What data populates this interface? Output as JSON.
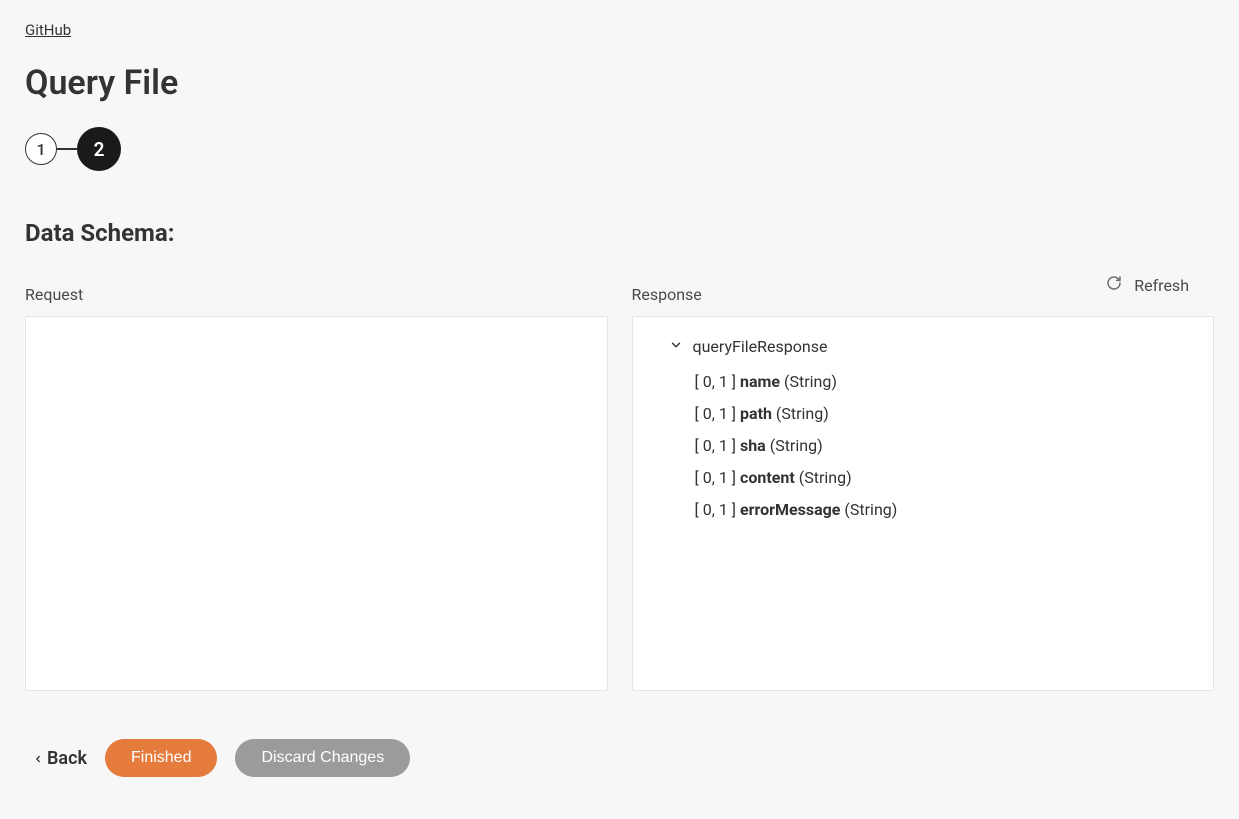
{
  "breadcrumb": {
    "label": "GitHub"
  },
  "page": {
    "title": "Query File"
  },
  "stepper": {
    "steps": [
      "1",
      "2"
    ],
    "activeIndex": 1
  },
  "section": {
    "title": "Data Schema:"
  },
  "toolbar": {
    "refresh_label": "Refresh"
  },
  "panels": {
    "request": {
      "label": "Request"
    },
    "response": {
      "label": "Response",
      "tree": {
        "root": "queryFileResponse",
        "fields": [
          {
            "cardinality": "[ 0, 1 ]",
            "name": "name",
            "type": "(String)"
          },
          {
            "cardinality": "[ 0, 1 ]",
            "name": "path",
            "type": "(String)"
          },
          {
            "cardinality": "[ 0, 1 ]",
            "name": "sha",
            "type": "(String)"
          },
          {
            "cardinality": "[ 0, 1 ]",
            "name": "content",
            "type": "(String)"
          },
          {
            "cardinality": "[ 0, 1 ]",
            "name": "errorMessage",
            "type": "(String)"
          }
        ]
      }
    }
  },
  "footer": {
    "back_label": "Back",
    "finished_label": "Finished",
    "discard_label": "Discard Changes"
  }
}
